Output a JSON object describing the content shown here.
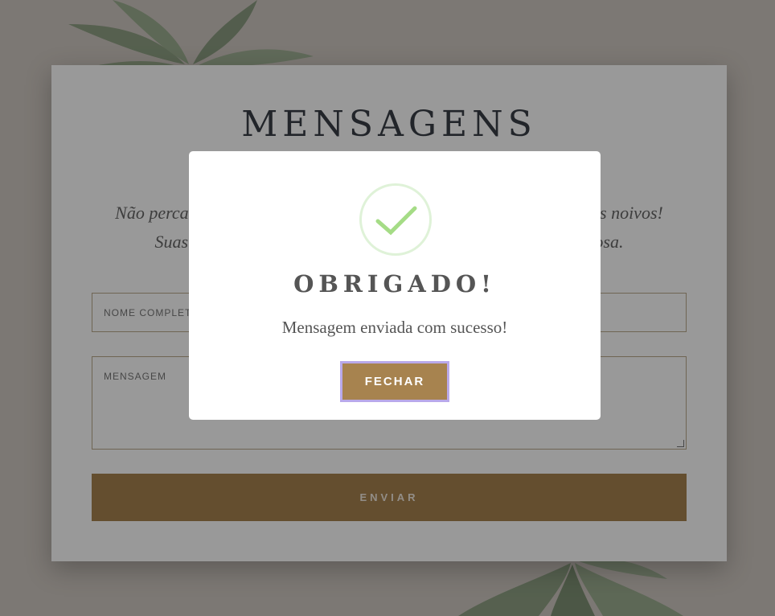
{
  "section": {
    "title": "MENSAGENS",
    "intro_line_1": "Não perca a oportunidade de deixar uma mensagem especial para os noivos!",
    "intro_line_2": "Suas mensagens de carinho e amor serão uma lembrança valiosa."
  },
  "form": {
    "name_placeholder": "NOME COMPLETO",
    "message_placeholder": "MENSAGEM",
    "submit_label": "ENVIAR"
  },
  "modal": {
    "title": "OBRIGADO!",
    "message": "Mensagem enviada com sucesso!",
    "close_label": "FECHAR"
  },
  "colors": {
    "accent": "#a7834f",
    "success": "#a5dc86",
    "focus_ring": "#b9a9ea"
  },
  "icons": {
    "modal_icon": "check-icon"
  }
}
